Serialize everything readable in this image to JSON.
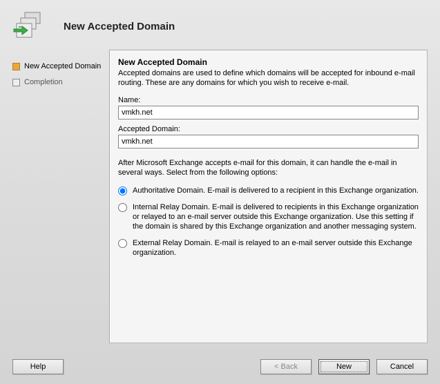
{
  "header": {
    "title": "New Accepted Domain"
  },
  "sidebar": {
    "steps": [
      {
        "label": "New Accepted Domain",
        "active": true
      },
      {
        "label": "Completion",
        "active": false
      }
    ]
  },
  "content": {
    "section_title": "New Accepted Domain",
    "description": "Accepted domains are used to define which domains will be accepted for inbound e-mail routing.  These are any domains for which you wish to receive e-mail.",
    "name_label": "Name:",
    "name_value": "vmkh.net",
    "accepted_domain_label": "Accepted Domain:",
    "accepted_domain_value": "vmkh.net",
    "options_intro": "After Microsoft Exchange accepts e-mail for this domain, it can handle the e-mail in several ways. Select from the following options:",
    "options": {
      "authoritative": "Authoritative Domain. E-mail is delivered to a recipient in this Exchange organization.",
      "internal_relay": "Internal Relay Domain. E-mail is delivered to recipients in this Exchange organization or relayed to an e-mail server outside this Exchange organization. Use this setting if the domain is shared by this Exchange organization and another messaging system.",
      "external_relay": "External Relay Domain. E-mail is relayed to an e-mail server outside this Exchange organization."
    }
  },
  "buttons": {
    "help": "Help",
    "back": "< Back",
    "new": "New",
    "cancel": "Cancel"
  }
}
